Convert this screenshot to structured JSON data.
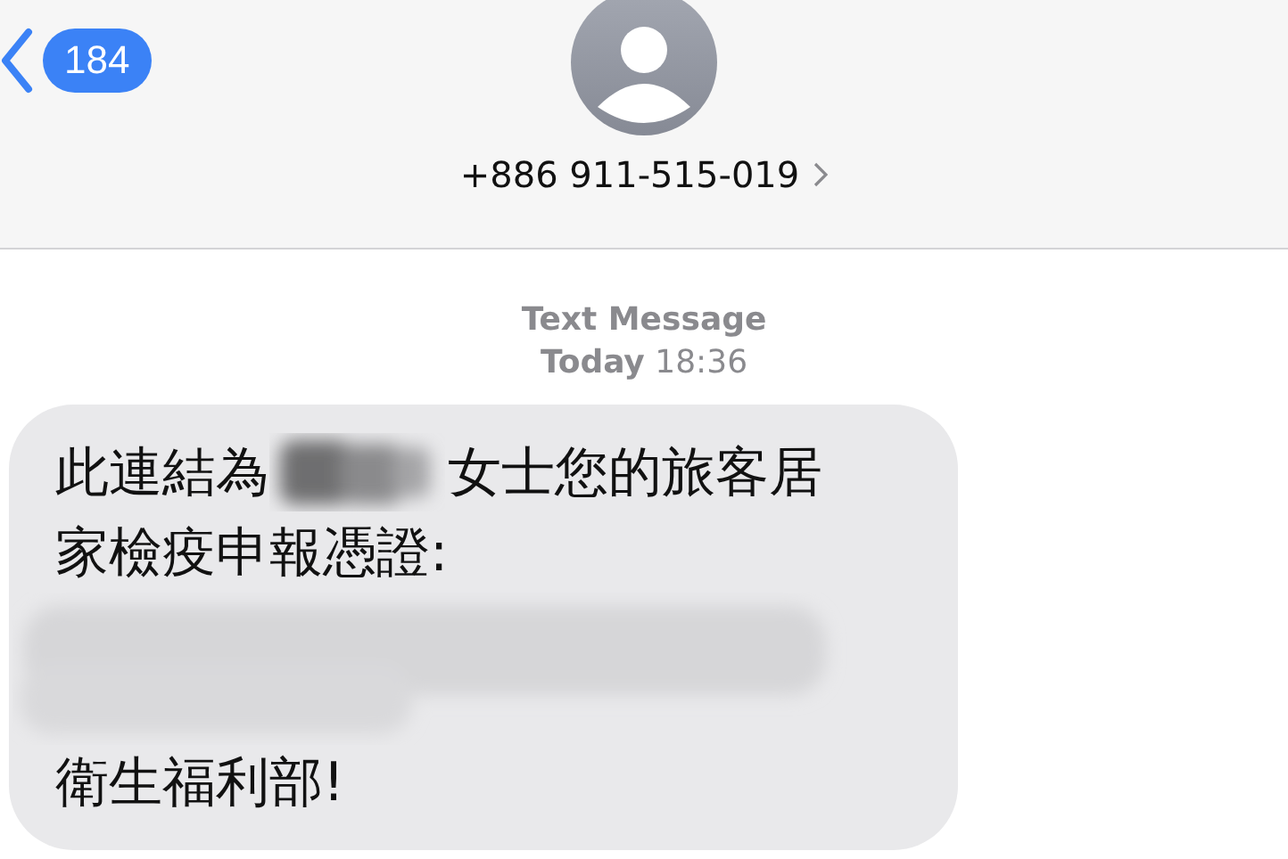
{
  "header": {
    "back_badge": "184",
    "contact": "+886 911-515-019"
  },
  "meta": {
    "label": "Text Message",
    "day": "Today",
    "time": "18:36"
  },
  "message": {
    "lines": [
      [
        {
          "kind": "text",
          "text": "此連結為"
        },
        {
          "kind": "redacted"
        },
        {
          "kind": "text",
          "text": "女士您的旅客居"
        }
      ],
      [
        {
          "kind": "text",
          "text": "家檢疫申報憑證:"
        }
      ],
      [
        {
          "kind": "redacted_link"
        }
      ],
      [
        {
          "kind": "text",
          "text": "衛生福利部!"
        }
      ]
    ]
  }
}
